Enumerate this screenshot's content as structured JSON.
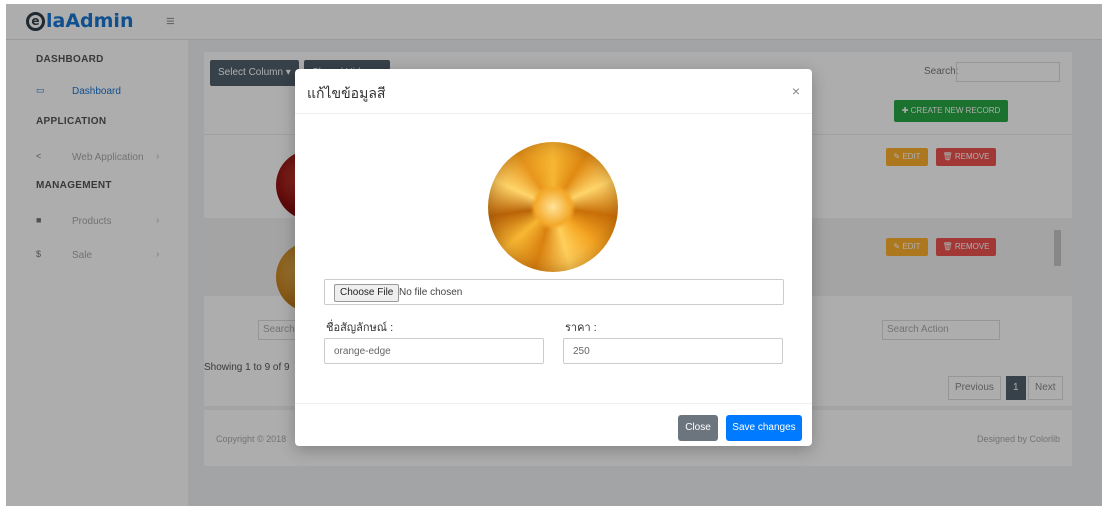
{
  "header": {
    "logo_letter": "e",
    "logo_text": "laAdmin",
    "menu_icon": "hamburger-icon"
  },
  "sidebar": {
    "sections": [
      "DASHBOARD",
      "APPLICATION",
      "MANAGEMENT"
    ],
    "items": [
      {
        "label": "Dashboard",
        "icon": "monitor-icon"
      },
      {
        "label": "Web Application",
        "icon": "share-icon"
      },
      {
        "label": "Products",
        "icon": "box-icon"
      },
      {
        "label": "Sale",
        "icon": "dollar-icon"
      }
    ]
  },
  "table": {
    "column_button": "Select Column ▾",
    "second_button": "Show / Hide",
    "search_label": "Search:",
    "create_button": "✚ CREATE NEW RECORD",
    "edit_label": "✎ EDIT",
    "remove_label": "🗑 REMOVE",
    "search_placeholder_left": "Search ty",
    "search_placeholder_action": "Search Action",
    "showing_text": "Showing 1 to 9 of 9",
    "pager": {
      "previous": "Previous",
      "page": "1",
      "next": "Next"
    }
  },
  "footer": {
    "copyright": "Copyright © 2018",
    "designed_by": "Designed by Colorlib"
  },
  "modal": {
    "title": "แก้ไขข้อมูลสี",
    "close_symbol": "×",
    "file_button": "Choose File",
    "file_status": "No file chosen",
    "name_label": "ชื่อสัญลักษณ์ :",
    "name_value": "orange-edge",
    "price_label": "ราคา :",
    "price_value": "250",
    "close_button": "Close",
    "save_button": "Save changes"
  },
  "colors": {
    "primary": "#007bff",
    "secondary": "#6c757d",
    "success": "#28a745",
    "warning": "#ffb22b",
    "danger": "#ef5350",
    "brand": "#1976d2"
  }
}
